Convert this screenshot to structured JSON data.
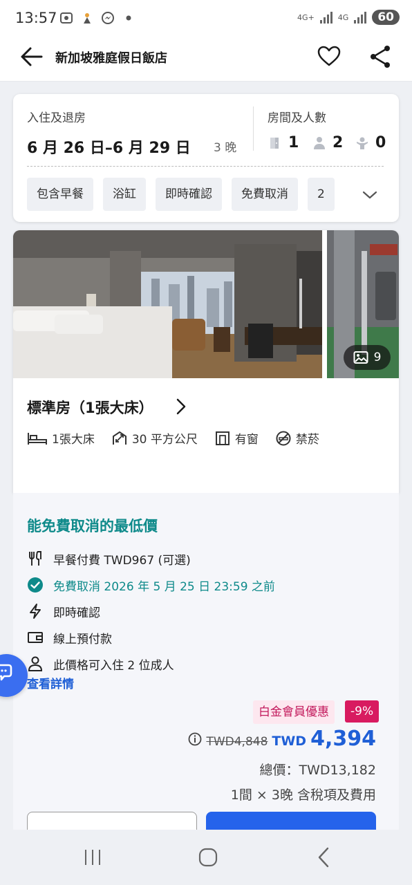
{
  "status_bar": {
    "time": "13:57",
    "network_1": "4G+",
    "network_2": "4G",
    "battery": "60",
    "icons": [
      "screenshot-icon",
      "app-icon",
      "messenger-icon",
      "dot-icon"
    ]
  },
  "app_bar": {
    "title": "新加坡雅庭假日飯店",
    "icons": [
      "back-arrow-icon",
      "heart-icon",
      "share-icon"
    ]
  },
  "search": {
    "dates_label": "入住及退房",
    "date_range": "6 月 26 日–6 月 29 日",
    "nights": "3 晚",
    "rooms_label": "房間及人數",
    "rooms": "1",
    "adults": "2",
    "children": "0",
    "filters": [
      "包含早餐",
      "浴缸",
      "即時確認",
      "免費取消",
      "2"
    ]
  },
  "room": {
    "photo_count": "9",
    "name": "標準房（1張大床）",
    "features": [
      {
        "icon": "bed-icon",
        "label": "1張大床"
      },
      {
        "icon": "area-icon",
        "label": "30 平方公尺"
      },
      {
        "icon": "window-icon",
        "label": "有窗"
      },
      {
        "icon": "no-smoking-icon",
        "label": "禁菸"
      }
    ]
  },
  "rate": {
    "title": "能免費取消的最低價",
    "items": [
      {
        "icon": "utensils-icon",
        "label": "早餐付費 TWD967 (可選)",
        "highlight": false
      },
      {
        "icon": "check-circle-icon",
        "label": "免費取消 2026 年 5 月 25 日 23:59 之前",
        "highlight": true
      },
      {
        "icon": "lightning-icon",
        "label": "即時確認",
        "highlight": false
      },
      {
        "icon": "wallet-icon",
        "label": "線上預付款",
        "highlight": false
      },
      {
        "icon": "person-icon",
        "label": "此價格可入住 2 位成人",
        "highlight": false
      }
    ],
    "details_link": "查看詳情",
    "member_badge": "白金會員優惠",
    "discount": "-9%",
    "old_price": "TWD4,848",
    "currency": "TWD",
    "price": "4,394",
    "total": "總價：TWD13,182",
    "total_note": "1間 × 3晚 含稅項及費用"
  },
  "colors": {
    "accent_blue": "#1f5fd6",
    "teal": "#0e8a8a",
    "discount_pink": "#d81b60"
  }
}
